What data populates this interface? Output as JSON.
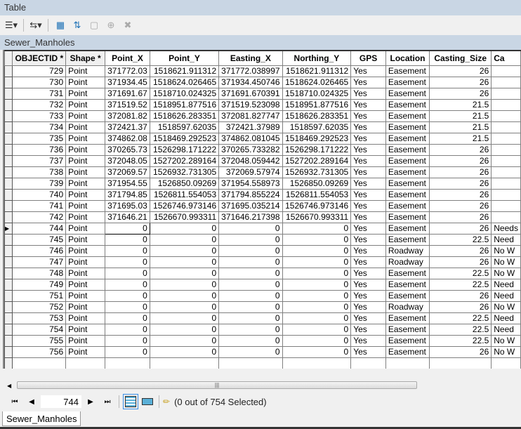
{
  "window": {
    "title": "Table"
  },
  "toolbar": {
    "icons": [
      "table-options-icon",
      "related-tables-icon",
      "select-by-attributes-icon",
      "switch-selection-icon",
      "clear-selection-icon",
      "zoom-to-selected-icon",
      "delete-selected-icon"
    ]
  },
  "layer": {
    "name": "Sewer_Manholes"
  },
  "table": {
    "columns": [
      "OBJECTID *",
      "Shape *",
      "Point_X",
      "Point_Y",
      "Easting_X",
      "Northing_Y",
      "GPS",
      "Location",
      "Casting_Size",
      "Ca"
    ],
    "rows": [
      [
        "729",
        "Point",
        "371772.03",
        "1518621.911312",
        "371772.038997",
        "1518621.911312",
        "Yes",
        "Easement",
        "26",
        ""
      ],
      [
        "730",
        "Point",
        "371934.45",
        "1518624.026465",
        "371934.450746",
        "1518624.026465",
        "Yes",
        "Easement",
        "26",
        ""
      ],
      [
        "731",
        "Point",
        "371691.67",
        "1518710.024325",
        "371691.670391",
        "1518710.024325",
        "Yes",
        "Easement",
        "26",
        ""
      ],
      [
        "732",
        "Point",
        "371519.52",
        "1518951.877516",
        "371519.523098",
        "1518951.877516",
        "Yes",
        "Easement",
        "21.5",
        ""
      ],
      [
        "733",
        "Point",
        "372081.82",
        "1518626.283351",
        "372081.827747",
        "1518626.283351",
        "Yes",
        "Easement",
        "21.5",
        ""
      ],
      [
        "734",
        "Point",
        "372421.37",
        "1518597.62035",
        "372421.37989",
        "1518597.62035",
        "Yes",
        "Easement",
        "21.5",
        ""
      ],
      [
        "735",
        "Point",
        "374862.08",
        "1518469.292523",
        "374862.081045",
        "1518469.292523",
        "Yes",
        "Easement",
        "21.5",
        ""
      ],
      [
        "736",
        "Point",
        "370265.73",
        "1526298.171222",
        "370265.733282",
        "1526298.171222",
        "Yes",
        "Easement",
        "26",
        ""
      ],
      [
        "737",
        "Point",
        "372048.05",
        "1527202.289164",
        "372048.059442",
        "1527202.289164",
        "Yes",
        "Easement",
        "26",
        ""
      ],
      [
        "738",
        "Point",
        "372069.57",
        "1526932.731305",
        "372069.57974",
        "1526932.731305",
        "Yes",
        "Easement",
        "26",
        ""
      ],
      [
        "739",
        "Point",
        "371954.55",
        "1526850.09269",
        "371954.558973",
        "1526850.09269",
        "Yes",
        "Easement",
        "26",
        ""
      ],
      [
        "740",
        "Point",
        "371794.85",
        "1526811.554053",
        "371794.855224",
        "1526811.554053",
        "Yes",
        "Easement",
        "26",
        ""
      ],
      [
        "741",
        "Point",
        "371695.03",
        "1526746.973146",
        "371695.035214",
        "1526746.973146",
        "Yes",
        "Easement",
        "26",
        ""
      ],
      [
        "742",
        "Point",
        "371646.21",
        "1526670.993311",
        "371646.217398",
        "1526670.993311",
        "Yes",
        "Easement",
        "26",
        ""
      ],
      [
        "744",
        "Point",
        "0",
        "0",
        "0",
        "0",
        "Yes",
        "Easement",
        "26",
        "Needs"
      ],
      [
        "745",
        "Point",
        "0",
        "0",
        "0",
        "0",
        "Yes",
        "Easement",
        "22.5",
        "Need"
      ],
      [
        "746",
        "Point",
        "0",
        "0",
        "0",
        "0",
        "Yes",
        "Roadway",
        "26",
        "No W"
      ],
      [
        "747",
        "Point",
        "0",
        "0",
        "0",
        "0",
        "Yes",
        "Roadway",
        "26",
        "No W"
      ],
      [
        "748",
        "Point",
        "0",
        "0",
        "0",
        "0",
        "Yes",
        "Easement",
        "22.5",
        "No W"
      ],
      [
        "749",
        "Point",
        "0",
        "0",
        "0",
        "0",
        "Yes",
        "Easement",
        "22.5",
        "Need"
      ],
      [
        "751",
        "Point",
        "0",
        "0",
        "0",
        "0",
        "Yes",
        "Easement",
        "26",
        "Need"
      ],
      [
        "752",
        "Point",
        "0",
        "0",
        "0",
        "0",
        "Yes",
        "Roadway",
        "26",
        "No W"
      ],
      [
        "753",
        "Point",
        "0",
        "0",
        "0",
        "0",
        "Yes",
        "Easement",
        "22.5",
        "Need"
      ],
      [
        "754",
        "Point",
        "0",
        "0",
        "0",
        "0",
        "Yes",
        "Easement",
        "22.5",
        "Need"
      ],
      [
        "755",
        "Point",
        "0",
        "0",
        "0",
        "0",
        "Yes",
        "Easement",
        "22.5",
        "No W"
      ],
      [
        "756",
        "Point",
        "0",
        "0",
        "0",
        "0",
        "Yes",
        "Easement",
        "26",
        "No W"
      ]
    ],
    "current_row_index": 14
  },
  "nav": {
    "current_record": "744",
    "status": "(0 out of 754 Selected)"
  },
  "tab": {
    "label": "Sewer_Manholes"
  }
}
